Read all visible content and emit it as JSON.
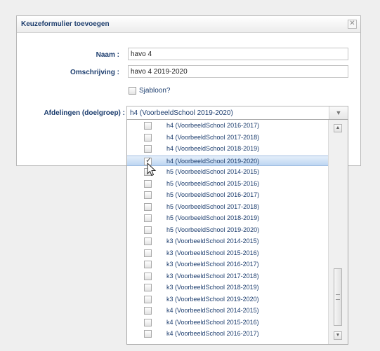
{
  "dialog": {
    "title": "Keuzeformulier toevoegen",
    "close_glyph": "✕"
  },
  "form": {
    "naam_label": "Naam :",
    "naam_value": "havo 4",
    "omschrijving_label": "Omschrijving :",
    "omschrijving_value": "havo 4 2019-2020",
    "sjabloon_label": "Sjabloon?",
    "sjabloon_checked": false,
    "afdelingen_label": "Afdelingen (doelgroep) :",
    "afdelingen_selected": "h4 (VoorbeeldSchool 2019-2020)"
  },
  "dropdown": {
    "options": [
      {
        "label": "h4 (VoorbeeldSchool 2016-2017)",
        "checked": false
      },
      {
        "label": "h4 (VoorbeeldSchool 2017-2018)",
        "checked": false
      },
      {
        "label": "h4 (VoorbeeldSchool 2018-2019)",
        "checked": false
      },
      {
        "label": "h4 (VoorbeeldSchool 2019-2020)",
        "checked": true
      },
      {
        "label": "h5 (VoorbeeldSchool 2014-2015)",
        "checked": false
      },
      {
        "label": "h5 (VoorbeeldSchool 2015-2016)",
        "checked": false
      },
      {
        "label": "h5 (VoorbeeldSchool 2016-2017)",
        "checked": false
      },
      {
        "label": "h5 (VoorbeeldSchool 2017-2018)",
        "checked": false
      },
      {
        "label": "h5 (VoorbeeldSchool 2018-2019)",
        "checked": false
      },
      {
        "label": "h5 (VoorbeeldSchool 2019-2020)",
        "checked": false
      },
      {
        "label": "k3 (VoorbeeldSchool 2014-2015)",
        "checked": false
      },
      {
        "label": "k3 (VoorbeeldSchool 2015-2016)",
        "checked": false
      },
      {
        "label": "k3 (VoorbeeldSchool 2016-2017)",
        "checked": false
      },
      {
        "label": "k3 (VoorbeeldSchool 2017-2018)",
        "checked": false
      },
      {
        "label": "k3 (VoorbeeldSchool 2018-2019)",
        "checked": false
      },
      {
        "label": "k3 (VoorbeeldSchool 2019-2020)",
        "checked": false
      },
      {
        "label": "k4 (VoorbeeldSchool 2014-2015)",
        "checked": false
      },
      {
        "label": "k4 (VoorbeeldSchool 2015-2016)",
        "checked": false
      },
      {
        "label": "k4 (VoorbeeldSchool 2016-2017)",
        "checked": false
      }
    ]
  },
  "icons": {
    "close": "close-icon",
    "dropdown_arrow": "chevron-down-icon",
    "scroll_up": "scroll-up-arrow-icon",
    "scroll_down": "scroll-down-arrow-icon",
    "cursor": "mouse-pointer-icon"
  },
  "colors": {
    "label_text": "#1c3d6e",
    "selected_row": "#bdd6f2",
    "dialog_border": "#b9b9b9"
  }
}
